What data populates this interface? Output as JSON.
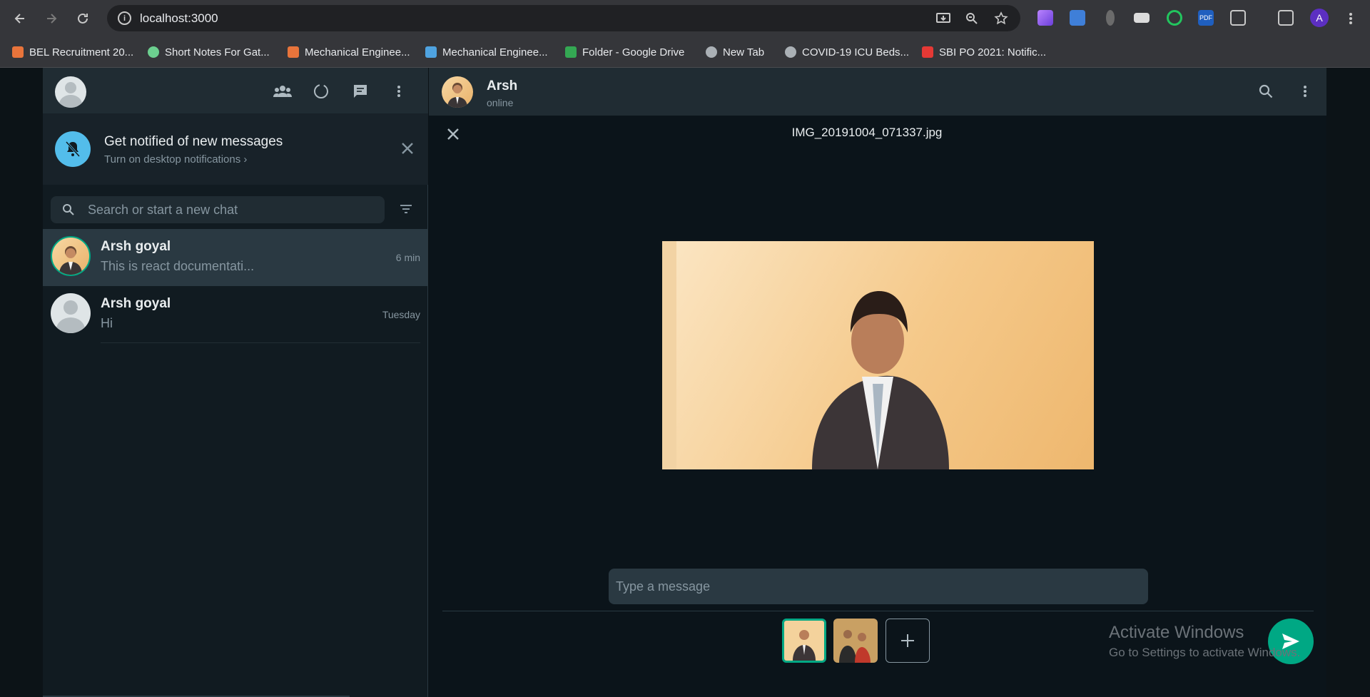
{
  "browser": {
    "url": "localhost:3000",
    "profile_initial": "A",
    "bookmarks": [
      {
        "label": "BEL Recruitment 20...",
        "color": "#e8743b"
      },
      {
        "label": "Short Notes For Gat...",
        "color": "#6ccf8f"
      },
      {
        "label": "Mechanical Enginee...",
        "color": "#e8743b"
      },
      {
        "label": "Mechanical Enginee...",
        "color": "#4fa3e0"
      },
      {
        "label": "Folder - Google Drive",
        "color": "#34a853"
      },
      {
        "label": "New Tab",
        "color": "#aab0b5"
      },
      {
        "label": "COVID-19 ICU Beds...",
        "color": "#aab0b5"
      },
      {
        "label": "SBI PO 2021: Notific...",
        "color": "#e53935"
      }
    ]
  },
  "sidebar": {
    "notification": {
      "title": "Get notified of new messages",
      "subtitle": "Turn on desktop notifications ›"
    },
    "search_placeholder": "Search or start a new chat",
    "chats": [
      {
        "name": "Arsh goyal",
        "message": "This is react documentati...",
        "time": "6 min"
      },
      {
        "name": "Arsh goyal",
        "message": "Hi",
        "time": "Tuesday"
      }
    ]
  },
  "conversation": {
    "contact_name": "Arsh",
    "contact_status": "online",
    "file_name": "IMG_20191004_071337.jpg",
    "caption_placeholder": "Type a message"
  },
  "system": {
    "watermark_title": "Activate Windows",
    "watermark_subtitle": "Go to Settings to activate Windows."
  },
  "colors": {
    "accent": "#00a884",
    "panel": "#111b21",
    "header": "#202c33",
    "bell": "#53bdeb"
  }
}
